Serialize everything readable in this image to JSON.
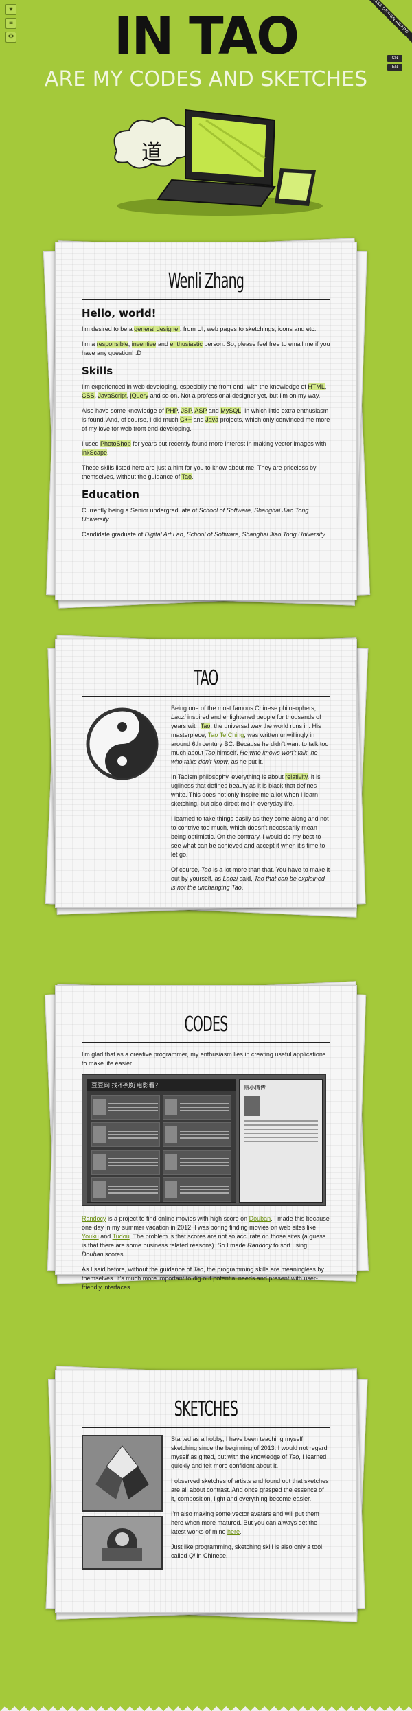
{
  "side_icons": [
    "heart-icon",
    "list-icon",
    "gear-icon"
  ],
  "ribbon": "CSS3 DESIGN AWARD",
  "lang_tags": [
    "CN",
    "EN"
  ],
  "header": {
    "title": "IN TAO",
    "subtitle": "ARE MY CODES AND SKETCHES",
    "hero_glyph": "道"
  },
  "about": {
    "title": "Wenli Zhang",
    "hello_heading": "Hello, world!",
    "p1_a": "I'm desired to be a ",
    "p1_hl": "general designer",
    "p1_b": ", from UI, web pages to sketchings, icons and etc.",
    "p2_a": "I'm a ",
    "p2_hl1": "responsible",
    "p2_sep1": ", ",
    "p2_hl2": "inventive",
    "p2_sep2": " and ",
    "p2_hl3": "enthusiastic",
    "p2_b": " person. So, please feel free to email me if you have any question! :D",
    "skills_heading": "Skills",
    "s1_a": "I'm experienced in web developing, especially the front end, with the knowledge of ",
    "s1_hl1": "HTML",
    "s1_sep1": ", ",
    "s1_hl2": "CSS",
    "s1_sep2": ", ",
    "s1_hl3": "JavaScript",
    "s1_sep3": ", ",
    "s1_hl4": "jQuery",
    "s1_b": " and so on. Not a professional designer yet, but I'm on my way..",
    "s2_a": "Also have some knowledge of ",
    "s2_hl1": "PHP",
    "s2_sep1": ", ",
    "s2_hl2": "JSP",
    "s2_sep2": ", ",
    "s2_hl3": "ASP",
    "s2_sep3": " and ",
    "s2_hl4": "MySQL",
    "s2_b": ", in which little extra enthusiasm is found. And, of course, I did much ",
    "s2_hl5": "C++",
    "s2_sep5": " and ",
    "s2_hl6": "Java",
    "s2_c": " projects, which only convinced me more of my love for web front end developing.",
    "s3_a": "I used ",
    "s3_hl1": "PhotoShop",
    "s3_b": " for years but recently found more interest in making vector images with ",
    "s3_hl2": "inkScape",
    "s3_c": ".",
    "s4_a": "These skills listed here are just a hint for you to know about me. They are priceless by themselves, without the guidance of ",
    "s4_hl": "Tao",
    "s4_b": ".",
    "edu_heading": "Education",
    "e1_a": "Currently being a Senior undergraduate of ",
    "e1_em": "School of Software, Shanghai Jiao Tong University",
    "e1_b": ".",
    "e2_a": "Candidate graduate of ",
    "e2_em1": "Digital Art Lab",
    "e2_sep": ", ",
    "e2_em2": "School of Software, Shanghai Jiao Tong University",
    "e2_b": "."
  },
  "tao": {
    "title": "TAO",
    "p1_a": "Being one of the most famous Chinese philosophers, ",
    "p1_em1": "Laozi",
    "p1_b": " inspired and enlightened people for thousands of years with ",
    "p1_hl": "Tao",
    "p1_c": ", the universal way the world runs in. His masterpiece, ",
    "p1_link": "Tao Te Ching",
    "p1_d": ", was written unwillingly in around 6th century BC. Because he didn't want to talk too much about ",
    "p1_em2": "Tao",
    "p1_e": " himself. ",
    "p1_em3": "He who knows won't talk, he who talks don't know",
    "p1_f": ", as he put it.",
    "p2_a": "In Taoism philosophy, everything is about ",
    "p2_hl": "relativity",
    "p2_b": ". It is ugliness that defines beauty as it is black that defines white. This does not only inspire me a lot when I learn sketching, but also direct me in everyday life.",
    "p3": "I learned to take things easily as they come along and not to contrive too much, which doesn't necessarily mean being optimistic. On the contrary, I would do my best to see what can be achieved and accept it when it's time to let go.",
    "p4_a": "Of course, ",
    "p4_em1": "Tao",
    "p4_b": " is a lot more than that. You have to make it out by yourself, as ",
    "p4_em2": "Laozi",
    "p4_c": " said, ",
    "p4_em3": "Tao that can be explained is not the unchanging Tao",
    "p4_d": "."
  },
  "codes": {
    "title": "CODES",
    "intro": "I'm glad that as a creative programmer, my enthusiasm lies in creating useful applications to make life easier.",
    "shot_header": "豆豆网  找不到好电影看？",
    "shot_side_title": "聂小倩传",
    "p1_link1": "Randocy",
    "p1_a": " is a project to find online movies with high score on ",
    "p1_link2": "Douban",
    "p1_b": ". I made this because one day in my summer vacation in 2012, I was boring finding movies on web sites like ",
    "p1_link3": "Youku",
    "p1_c": " and ",
    "p1_link4": "Tudou",
    "p1_d": ". The problem is that scores are not so accurate on those sites (a guess is that there are some business related reasons). So I made ",
    "p1_em1": "Randocy",
    "p1_e": " to sort using ",
    "p1_em2": "Douban",
    "p1_f": " scores.",
    "p2_a": "As I said before, without the guidance of ",
    "p2_em": "Tao",
    "p2_b": ", the programming skills are meaningless by themselves. It's much more important to dig out potential needs and present with user-friendly interfaces."
  },
  "sketches": {
    "title": "SKETCHES",
    "p1_a": "Started as a hobby, I have been teaching myself sketching since the beginning of 2013. I would not regard myself as gifted, but with the knowledge of ",
    "p1_em": "Tao",
    "p1_b": ", I learned quickly and felt more confident about it.",
    "p2": "I observed sketches of artists and found out that sketches are all about contrast. And once grasped the essence of it, composition, light and everything become easier.",
    "p3_a": "I'm also making some vector avatars and will put them here when more matured. But you can always get the latest works of mine ",
    "p3_link": "here",
    "p3_b": ".",
    "p4_a": "Just like programming, sketching skill is also only a tool, called ",
    "p4_em": "Qi",
    "p4_b": " in Chinese."
  }
}
